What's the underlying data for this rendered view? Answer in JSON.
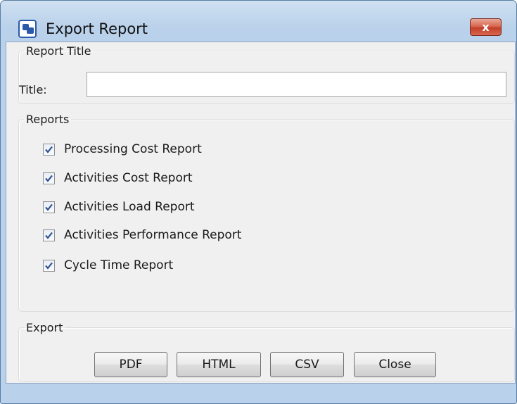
{
  "window": {
    "title": "Export Report",
    "close_symbol": "x",
    "app_icon": "app-logo-icon"
  },
  "report_title_group": {
    "legend": "Report Title",
    "label": "Title:",
    "value": ""
  },
  "reports_group": {
    "legend": "Reports",
    "items": [
      {
        "label": "Processing Cost Report",
        "checked": true
      },
      {
        "label": "Activities Cost Report",
        "checked": true
      },
      {
        "label": "Activities Load Report",
        "checked": true
      },
      {
        "label": "Activities Performance Report",
        "checked": true
      },
      {
        "label": "Cycle Time Report",
        "checked": true
      }
    ]
  },
  "export_group": {
    "legend": "Export",
    "buttons": {
      "pdf": "PDF",
      "html": "HTML",
      "csv": "CSV",
      "close": "Close"
    }
  },
  "colors": {
    "frame": "#b9d1ea",
    "client": "#f0f0f0",
    "close_button": "#c8472f",
    "checkmark": "#2d4f8f"
  }
}
